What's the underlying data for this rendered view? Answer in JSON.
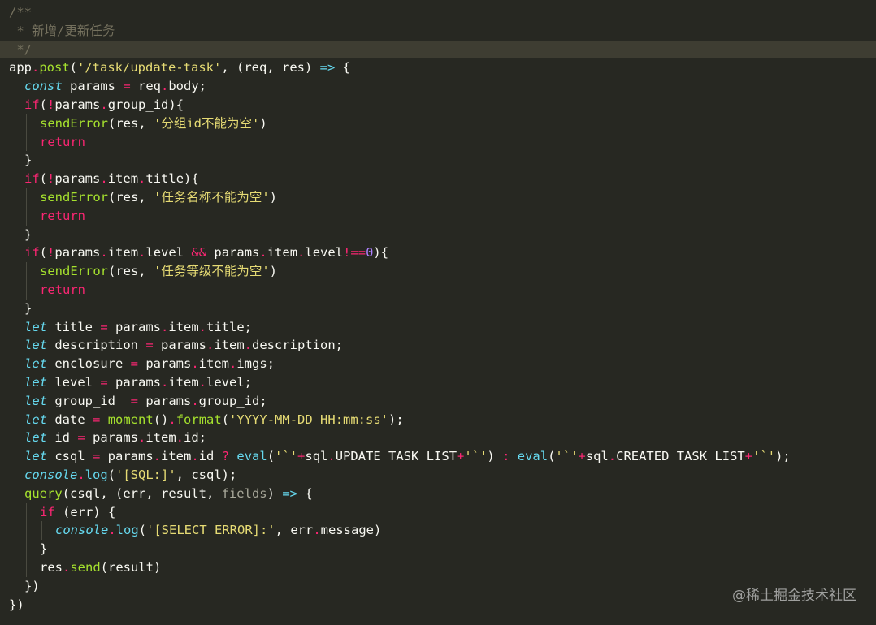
{
  "editor": {
    "theme_colors": {
      "background": "#272822",
      "comment": "#75715e",
      "keyword": "#f92672",
      "function": "#a6e22e",
      "string": "#e6db74",
      "number": "#ae81ff",
      "storage": "#66d9ef",
      "text": "#f8f8f2"
    },
    "highlighted_line": 3,
    "lines": [
      {
        "indent": 0,
        "tokens": [
          [
            "/**",
            "comment"
          ]
        ]
      },
      {
        "indent": 0,
        "tokens": [
          [
            " * 新增/更新任务",
            "comment"
          ]
        ]
      },
      {
        "indent": 0,
        "tokens": [
          [
            " */",
            "comment"
          ]
        ]
      },
      {
        "indent": 0,
        "tokens": [
          [
            "app",
            "plain"
          ],
          [
            ".",
            "dot"
          ],
          [
            "post",
            "fn"
          ],
          [
            "(",
            "plain"
          ],
          [
            "'/task/update-task'",
            "str"
          ],
          [
            ", (req, res) ",
            "plain"
          ],
          [
            "=>",
            "fnc"
          ],
          [
            " {",
            "plain"
          ]
        ]
      },
      {
        "indent": 1,
        "tokens": [
          [
            "const",
            "storage"
          ],
          [
            " params ",
            "plain"
          ],
          [
            "=",
            "op"
          ],
          [
            " req",
            "plain"
          ],
          [
            ".",
            "dot"
          ],
          [
            "body;",
            "plain"
          ]
        ]
      },
      {
        "indent": 1,
        "tokens": [
          [
            "if",
            "kw"
          ],
          [
            "(",
            "plain"
          ],
          [
            "!",
            "op"
          ],
          [
            "params",
            "plain"
          ],
          [
            ".",
            "dot"
          ],
          [
            "group_id){",
            "plain"
          ]
        ]
      },
      {
        "indent": 2,
        "tokens": [
          [
            "sendError",
            "fn"
          ],
          [
            "(res, ",
            "plain"
          ],
          [
            "'分组id不能为空'",
            "str"
          ],
          [
            ")",
            "plain"
          ]
        ]
      },
      {
        "indent": 2,
        "tokens": [
          [
            "return",
            "kw"
          ]
        ]
      },
      {
        "indent": 1,
        "tokens": [
          [
            "}",
            "plain"
          ]
        ]
      },
      {
        "indent": 1,
        "tokens": [
          [
            "if",
            "kw"
          ],
          [
            "(",
            "plain"
          ],
          [
            "!",
            "op"
          ],
          [
            "params",
            "plain"
          ],
          [
            ".",
            "dot"
          ],
          [
            "item",
            "plain"
          ],
          [
            ".",
            "dot"
          ],
          [
            "title){",
            "plain"
          ]
        ]
      },
      {
        "indent": 2,
        "tokens": [
          [
            "sendError",
            "fn"
          ],
          [
            "(res, ",
            "plain"
          ],
          [
            "'任务名称不能为空'",
            "str"
          ],
          [
            ")",
            "plain"
          ]
        ]
      },
      {
        "indent": 2,
        "tokens": [
          [
            "return",
            "kw"
          ]
        ]
      },
      {
        "indent": 1,
        "tokens": [
          [
            "}",
            "plain"
          ]
        ]
      },
      {
        "indent": 1,
        "tokens": [
          [
            "if",
            "kw"
          ],
          [
            "(",
            "plain"
          ],
          [
            "!",
            "op"
          ],
          [
            "params",
            "plain"
          ],
          [
            ".",
            "dot"
          ],
          [
            "item",
            "plain"
          ],
          [
            ".",
            "dot"
          ],
          [
            "level ",
            "plain"
          ],
          [
            "&&",
            "op"
          ],
          [
            " params",
            "plain"
          ],
          [
            ".",
            "dot"
          ],
          [
            "item",
            "plain"
          ],
          [
            ".",
            "dot"
          ],
          [
            "level",
            "plain"
          ],
          [
            "!==",
            "op"
          ],
          [
            "0",
            "num"
          ],
          [
            "){",
            "plain"
          ]
        ]
      },
      {
        "indent": 2,
        "tokens": [
          [
            "sendError",
            "fn"
          ],
          [
            "(res, ",
            "plain"
          ],
          [
            "'任务等级不能为空'",
            "str"
          ],
          [
            ")",
            "plain"
          ]
        ]
      },
      {
        "indent": 2,
        "tokens": [
          [
            "return",
            "kw"
          ]
        ]
      },
      {
        "indent": 1,
        "tokens": [
          [
            "}",
            "plain"
          ]
        ]
      },
      {
        "indent": 1,
        "tokens": [
          [
            "let",
            "storage"
          ],
          [
            " title ",
            "plain"
          ],
          [
            "=",
            "op"
          ],
          [
            " params",
            "plain"
          ],
          [
            ".",
            "dot"
          ],
          [
            "item",
            "plain"
          ],
          [
            ".",
            "dot"
          ],
          [
            "title;",
            "plain"
          ]
        ]
      },
      {
        "indent": 1,
        "tokens": [
          [
            "let",
            "storage"
          ],
          [
            " description ",
            "plain"
          ],
          [
            "=",
            "op"
          ],
          [
            " params",
            "plain"
          ],
          [
            ".",
            "dot"
          ],
          [
            "item",
            "plain"
          ],
          [
            ".",
            "dot"
          ],
          [
            "description;",
            "plain"
          ]
        ]
      },
      {
        "indent": 1,
        "tokens": [
          [
            "let",
            "storage"
          ],
          [
            " enclosure ",
            "plain"
          ],
          [
            "=",
            "op"
          ],
          [
            " params",
            "plain"
          ],
          [
            ".",
            "dot"
          ],
          [
            "item",
            "plain"
          ],
          [
            ".",
            "dot"
          ],
          [
            "imgs;",
            "plain"
          ]
        ]
      },
      {
        "indent": 1,
        "tokens": [
          [
            "let",
            "storage"
          ],
          [
            " level ",
            "plain"
          ],
          [
            "=",
            "op"
          ],
          [
            " params",
            "plain"
          ],
          [
            ".",
            "dot"
          ],
          [
            "item",
            "plain"
          ],
          [
            ".",
            "dot"
          ],
          [
            "level;",
            "plain"
          ]
        ]
      },
      {
        "indent": 1,
        "tokens": [
          [
            "let",
            "storage"
          ],
          [
            " group_id  ",
            "plain"
          ],
          [
            "=",
            "op"
          ],
          [
            " params",
            "plain"
          ],
          [
            ".",
            "dot"
          ],
          [
            "group_id;",
            "plain"
          ]
        ]
      },
      {
        "indent": 1,
        "tokens": [
          [
            "let",
            "storage"
          ],
          [
            " date ",
            "plain"
          ],
          [
            "=",
            "op"
          ],
          [
            " ",
            "plain"
          ],
          [
            "moment",
            "fn"
          ],
          [
            "()",
            "plain"
          ],
          [
            ".",
            "dot"
          ],
          [
            "format",
            "fn"
          ],
          [
            "(",
            "plain"
          ],
          [
            "'YYYY-MM-DD HH:mm:ss'",
            "str"
          ],
          [
            ");",
            "plain"
          ]
        ]
      },
      {
        "indent": 1,
        "tokens": [
          [
            "let",
            "storage"
          ],
          [
            " id ",
            "plain"
          ],
          [
            "=",
            "op"
          ],
          [
            " params",
            "plain"
          ],
          [
            ".",
            "dot"
          ],
          [
            "item",
            "plain"
          ],
          [
            ".",
            "dot"
          ],
          [
            "id;",
            "plain"
          ]
        ]
      },
      {
        "indent": 1,
        "tokens": [
          [
            "let",
            "storage"
          ],
          [
            " csql ",
            "plain"
          ],
          [
            "=",
            "op"
          ],
          [
            " params",
            "plain"
          ],
          [
            ".",
            "dot"
          ],
          [
            "item",
            "plain"
          ],
          [
            ".",
            "dot"
          ],
          [
            "id ",
            "plain"
          ],
          [
            "?",
            "op"
          ],
          [
            " ",
            "plain"
          ],
          [
            "eval",
            "fnc"
          ],
          [
            "(",
            "plain"
          ],
          [
            "'`'",
            "str"
          ],
          [
            "+",
            "op"
          ],
          [
            "sql",
            "plain"
          ],
          [
            ".",
            "dot"
          ],
          [
            "UPDATE_TASK_LIST",
            "plain"
          ],
          [
            "+",
            "op"
          ],
          [
            "'`'",
            "str"
          ],
          [
            ") ",
            "plain"
          ],
          [
            ":",
            "op"
          ],
          [
            " ",
            "plain"
          ],
          [
            "eval",
            "fnc"
          ],
          [
            "(",
            "plain"
          ],
          [
            "'`'",
            "str"
          ],
          [
            "+",
            "op"
          ],
          [
            "sql",
            "plain"
          ],
          [
            ".",
            "dot"
          ],
          [
            "CREATED_TASK_LIST",
            "plain"
          ],
          [
            "+",
            "op"
          ],
          [
            "'`'",
            "str"
          ],
          [
            ");",
            "plain"
          ]
        ]
      },
      {
        "indent": 1,
        "tokens": [
          [
            "console",
            "storage"
          ],
          [
            ".",
            "dot"
          ],
          [
            "log",
            "fnc"
          ],
          [
            "(",
            "plain"
          ],
          [
            "'[SQL:]'",
            "str"
          ],
          [
            ", csql);",
            "plain"
          ]
        ]
      },
      {
        "indent": 1,
        "tokens": [
          [
            "query",
            "fn"
          ],
          [
            "(csql, (err, result, ",
            "plain"
          ],
          [
            "fields",
            "dimparam"
          ],
          [
            ") ",
            "plain"
          ],
          [
            "=>",
            "fnc"
          ],
          [
            " {",
            "plain"
          ]
        ]
      },
      {
        "indent": 2,
        "tokens": [
          [
            "if",
            "kw"
          ],
          [
            " (err) {",
            "plain"
          ]
        ]
      },
      {
        "indent": 3,
        "tokens": [
          [
            "console",
            "storage"
          ],
          [
            ".",
            "dot"
          ],
          [
            "log",
            "fnc"
          ],
          [
            "(",
            "plain"
          ],
          [
            "'[SELECT ERROR]:'",
            "str"
          ],
          [
            ", err",
            "plain"
          ],
          [
            ".",
            "dot"
          ],
          [
            "message)",
            "plain"
          ]
        ]
      },
      {
        "indent": 2,
        "tokens": [
          [
            "}",
            "plain"
          ]
        ]
      },
      {
        "indent": 2,
        "tokens": [
          [
            "res",
            "plain"
          ],
          [
            ".",
            "dot"
          ],
          [
            "send",
            "fn"
          ],
          [
            "(result)",
            "plain"
          ]
        ]
      },
      {
        "indent": 1,
        "tokens": [
          [
            "})",
            "plain"
          ]
        ]
      },
      {
        "indent": 0,
        "tokens": [
          [
            "})",
            "plain"
          ]
        ]
      }
    ]
  },
  "watermark": "@稀土掘金技术社区"
}
